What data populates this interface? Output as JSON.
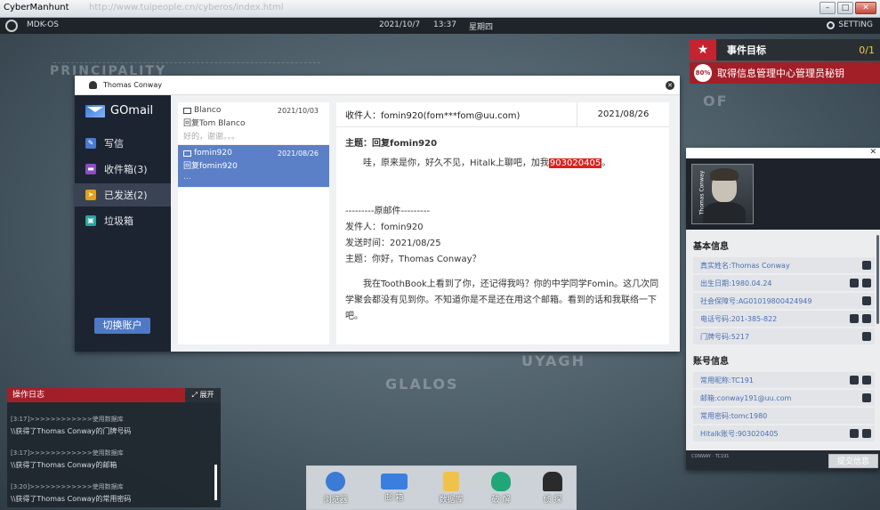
{
  "window": {
    "title": "CyberManhunt",
    "url": "http://www.tuipeople.cn/cyberos/index.html"
  },
  "os_bar": {
    "os_name": "MDK-OS",
    "date": "2021/10/7",
    "time": "13:37",
    "weekday": "星期四",
    "setting": "SETTING"
  },
  "map_labels": [
    "PRINCIPALITY",
    "OF",
    "GLALOS",
    "UYAGH"
  ],
  "mission": {
    "title": "事件目标",
    "count": "0/1",
    "task_progress": "80%",
    "task": "取得信息管理中心管理员秘钥"
  },
  "mail": {
    "window_user": "Thomas Conway",
    "brand": "GOmail",
    "nav": [
      {
        "label": "写信",
        "color": "#4a7bd0"
      },
      {
        "label": "收件箱(3)",
        "color": "#8a4fc0"
      },
      {
        "label": "已发送(2)",
        "color": "#e0a21a"
      },
      {
        "label": "垃圾箱",
        "color": "#2aa6a0"
      }
    ],
    "switch_account": "切换账户",
    "messages": [
      {
        "from": "Blanco",
        "date": "2021/10/03",
        "subject": "回复Tom Blanco",
        "preview": "好的，谢谢。。。"
      },
      {
        "from": "fomin920",
        "date": "2021/08/26",
        "subject": "回复fomin920",
        "preview": "..."
      }
    ],
    "reader": {
      "to": "收件人：fomin920(fom***fom@uu.com)",
      "date": "2021/08/26",
      "subject": "主题：回复fomin920",
      "line1_a": "哇，原来是你，好久不见，Hitalk上聊吧，加我",
      "line1_hl": "903020405",
      "line1_b": "。",
      "divider": "---------原邮件---------",
      "orig_from": "发件人：fomin920",
      "orig_time": "发送时间：2021/08/25",
      "orig_subject": "主题：你好，Thomas Conway？",
      "orig_body": "我在ToothBook上看到了你，还记得我吗？你的中学同学Fomin。这几次同学聚会都没有见到你。不知道你是不是还在用这个邮箱。看到的话和我联络一下吧。"
    }
  },
  "profile": {
    "name_tag": "Thomas Conway",
    "basic_title": "基本信息",
    "basic": [
      "真实姓名:Thomas Conway",
      "出生日期:1980.04.24",
      "社会保障号:AG01019800424949",
      "电话号码:201-385-822",
      "门牌号码:5217"
    ],
    "account_title": "账号信息",
    "account": [
      "常用昵称:TC191",
      "邮箱:conway191@uu.com",
      "常用密码:tomc1980",
      "Hitalk账号:903020405"
    ],
    "submit": "提交信息",
    "foot_text": "CONWAY · TC191"
  },
  "log": {
    "title": "操作日志",
    "expand": "展开",
    "entries": [
      {
        "meta": "[3:17]>>>>>>>>>>>>使用数据库",
        "text": "\\\\获得了Thomas Conway的门牌号码"
      },
      {
        "meta": "[3:17]>>>>>>>>>>>>使用数据库",
        "text": "\\\\获得了Thomas Conway的邮箱"
      },
      {
        "meta": "[3:20]>>>>>>>>>>>>使用数据库",
        "text": "\\\\获得了Thomas Conway的常用密码"
      }
    ]
  },
  "dock": [
    {
      "label": "浏览器",
      "icon": "globe-icon",
      "color": "#3b7bd6"
    },
    {
      "label": "邮 箱",
      "icon": "mail-icon",
      "color": "#3a7fe0"
    },
    {
      "label": "数据库",
      "icon": "database-icon",
      "color": "#f0c24a"
    },
    {
      "label": "破 解",
      "icon": "shield-key-icon",
      "color": "#21a679"
    },
    {
      "label": "侦 探",
      "icon": "detective-icon",
      "color": "#2b2b2b"
    }
  ]
}
